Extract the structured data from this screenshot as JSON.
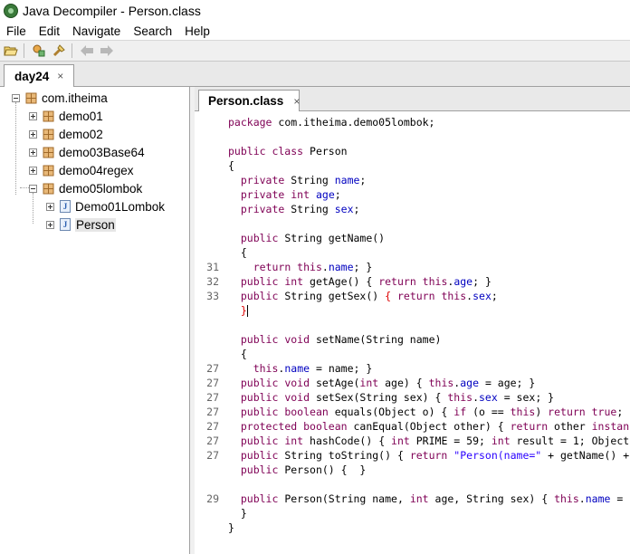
{
  "window": {
    "title": "Java Decompiler - Person.class"
  },
  "menu": [
    "File",
    "Edit",
    "Navigate",
    "Search",
    "Help"
  ],
  "toolbar": {
    "icons": [
      "open-file-icon",
      "open-type-icon",
      "search-icon",
      "back-arrow-icon",
      "forward-arrow-icon"
    ]
  },
  "main_tab": {
    "label": "day24",
    "close": "×"
  },
  "tree": {
    "items": [
      {
        "label": "com.itheima",
        "type": "package",
        "depth": 0,
        "state": "expanded"
      },
      {
        "label": "demo01",
        "type": "package",
        "depth": 1,
        "state": "collapsed"
      },
      {
        "label": "demo02",
        "type": "package",
        "depth": 1,
        "state": "collapsed"
      },
      {
        "label": "demo03Base64",
        "type": "package",
        "depth": 1,
        "state": "collapsed"
      },
      {
        "label": "demo04regex",
        "type": "package",
        "depth": 1,
        "state": "collapsed"
      },
      {
        "label": "demo05lombok",
        "type": "package",
        "depth": 1,
        "state": "expanded"
      },
      {
        "label": "Demo01Lombok",
        "type": "class",
        "depth": 2,
        "state": "collapsed"
      },
      {
        "label": "Person",
        "type": "class",
        "depth": 2,
        "state": "collapsed",
        "selected": true
      }
    ]
  },
  "editor": {
    "tab": {
      "label": "Person.class",
      "close": "×"
    },
    "lines": [
      {
        "n": "",
        "tokens": [
          [
            "kw",
            "package"
          ],
          [
            "t",
            " com.itheima.demo05lombok;"
          ]
        ]
      },
      {
        "n": "",
        "tokens": []
      },
      {
        "n": "",
        "tokens": [
          [
            "kw",
            "public class"
          ],
          [
            "t",
            " Person"
          ]
        ]
      },
      {
        "n": "",
        "tokens": [
          [
            "t",
            "{"
          ]
        ]
      },
      {
        "n": "",
        "tokens": [
          [
            "t",
            "  "
          ],
          [
            "kw",
            "private"
          ],
          [
            "t",
            " String "
          ],
          [
            "fld",
            "name"
          ],
          [
            "t",
            ";"
          ]
        ]
      },
      {
        "n": "",
        "tokens": [
          [
            "t",
            "  "
          ],
          [
            "kw",
            "private int"
          ],
          [
            "t",
            " "
          ],
          [
            "fld",
            "age"
          ],
          [
            "t",
            ";"
          ]
        ]
      },
      {
        "n": "",
        "tokens": [
          [
            "t",
            "  "
          ],
          [
            "kw",
            "private"
          ],
          [
            "t",
            " String "
          ],
          [
            "fld",
            "sex"
          ],
          [
            "t",
            ";"
          ]
        ]
      },
      {
        "n": "",
        "tokens": []
      },
      {
        "n": "",
        "tokens": [
          [
            "t",
            "  "
          ],
          [
            "kw",
            "public"
          ],
          [
            "t",
            " String getName()"
          ]
        ]
      },
      {
        "n": "",
        "tokens": [
          [
            "t",
            "  {"
          ]
        ]
      },
      {
        "n": "31",
        "tokens": [
          [
            "t",
            "    "
          ],
          [
            "kw",
            "return this"
          ],
          [
            "t",
            "."
          ],
          [
            "fld",
            "name"
          ],
          [
            "t",
            "; }"
          ]
        ]
      },
      {
        "n": "32",
        "tokens": [
          [
            "t",
            "  "
          ],
          [
            "kw",
            "public int"
          ],
          [
            "t",
            " getAge() { "
          ],
          [
            "kw",
            "return this"
          ],
          [
            "t",
            "."
          ],
          [
            "fld",
            "age"
          ],
          [
            "t",
            "; }"
          ]
        ]
      },
      {
        "n": "33",
        "tokens": [
          [
            "t",
            "  "
          ],
          [
            "kw",
            "public"
          ],
          [
            "t",
            " String getSex() "
          ],
          [
            "brk",
            "{"
          ],
          [
            "t",
            " "
          ],
          [
            "kw",
            "return this"
          ],
          [
            "t",
            "."
          ],
          [
            "fld",
            "sex"
          ],
          [
            "t",
            ";"
          ]
        ]
      },
      {
        "n": "",
        "tokens": [
          [
            "t",
            "  "
          ],
          [
            "brk",
            "}"
          ],
          [
            "cursor",
            ""
          ]
        ]
      },
      {
        "n": "",
        "tokens": []
      },
      {
        "n": "",
        "tokens": [
          [
            "t",
            "  "
          ],
          [
            "kw",
            "public void"
          ],
          [
            "t",
            " setName(String name)"
          ]
        ]
      },
      {
        "n": "",
        "tokens": [
          [
            "t",
            "  {"
          ]
        ]
      },
      {
        "n": "27",
        "tokens": [
          [
            "t",
            "    "
          ],
          [
            "kw",
            "this"
          ],
          [
            "t",
            "."
          ],
          [
            "fld",
            "name"
          ],
          [
            "t",
            " = name; }"
          ]
        ]
      },
      {
        "n": "27",
        "tokens": [
          [
            "t",
            "  "
          ],
          [
            "kw",
            "public void"
          ],
          [
            "t",
            " setAge("
          ],
          [
            "kw",
            "int"
          ],
          [
            "t",
            " age) { "
          ],
          [
            "kw",
            "this"
          ],
          [
            "t",
            "."
          ],
          [
            "fld",
            "age"
          ],
          [
            "t",
            " = age; }"
          ]
        ]
      },
      {
        "n": "27",
        "tokens": [
          [
            "t",
            "  "
          ],
          [
            "kw",
            "public void"
          ],
          [
            "t",
            " setSex(String sex) { "
          ],
          [
            "kw",
            "this"
          ],
          [
            "t",
            "."
          ],
          [
            "fld",
            "sex"
          ],
          [
            "t",
            " = sex; }"
          ]
        ]
      },
      {
        "n": "27",
        "tokens": [
          [
            "t",
            "  "
          ],
          [
            "kw",
            "public boolean"
          ],
          [
            "t",
            " equals(Object o) { "
          ],
          [
            "kw",
            "if"
          ],
          [
            "t",
            " (o == "
          ],
          [
            "kw",
            "this"
          ],
          [
            "t",
            ") "
          ],
          [
            "kw",
            "return true"
          ],
          [
            "t",
            ";"
          ]
        ]
      },
      {
        "n": "27",
        "tokens": [
          [
            "t",
            "  "
          ],
          [
            "kw",
            "protected boolean"
          ],
          [
            "t",
            " canEqual(Object other) { "
          ],
          [
            "kw",
            "return"
          ],
          [
            "t",
            " other "
          ],
          [
            "kw",
            "instan"
          ]
        ]
      },
      {
        "n": "27",
        "tokens": [
          [
            "t",
            "  "
          ],
          [
            "kw",
            "public int"
          ],
          [
            "t",
            " hashCode() { "
          ],
          [
            "kw",
            "int"
          ],
          [
            "t",
            " PRIME = 59; "
          ],
          [
            "kw",
            "int"
          ],
          [
            "t",
            " result = 1; Object"
          ]
        ]
      },
      {
        "n": "27",
        "tokens": [
          [
            "t",
            "  "
          ],
          [
            "kw",
            "public"
          ],
          [
            "t",
            " String toString() { "
          ],
          [
            "kw",
            "return"
          ],
          [
            "t",
            " "
          ],
          [
            "str",
            "\"Person(name=\""
          ],
          [
            "t",
            " + getName() +"
          ]
        ]
      },
      {
        "n": "",
        "tokens": [
          [
            "t",
            "  "
          ],
          [
            "kw",
            "public"
          ],
          [
            "t",
            " Person() {  }"
          ]
        ]
      },
      {
        "n": "",
        "tokens": []
      },
      {
        "n": "29",
        "tokens": [
          [
            "t",
            "  "
          ],
          [
            "kw",
            "public"
          ],
          [
            "t",
            " Person(String name, "
          ],
          [
            "kw",
            "int"
          ],
          [
            "t",
            " age, String sex) { "
          ],
          [
            "kw",
            "this"
          ],
          [
            "t",
            "."
          ],
          [
            "fld",
            "name"
          ],
          [
            "t",
            " ="
          ]
        ]
      },
      {
        "n": "",
        "tokens": [
          [
            "t",
            "  }"
          ]
        ]
      },
      {
        "n": "",
        "tokens": [
          [
            "t",
            "}"
          ]
        ]
      }
    ]
  },
  "colors": {
    "keyword": "#7f0055",
    "field": "#0000c0",
    "string": "#2a00ff",
    "bracket_match": "#dd0000"
  }
}
